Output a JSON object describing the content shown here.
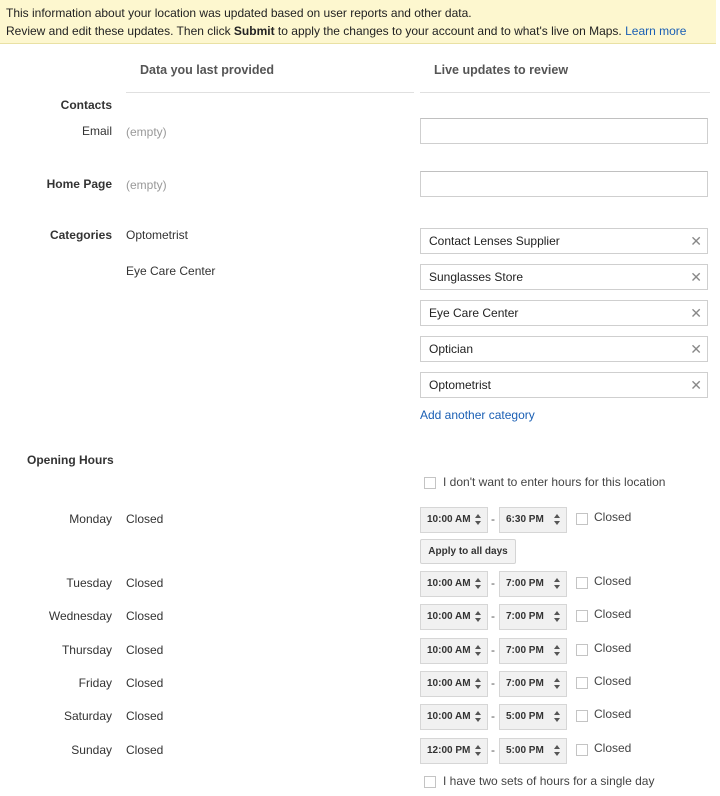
{
  "banner": {
    "line1": "This information about your location was updated based on user reports and other data.",
    "line2_a": "Review and edit these updates. Then click ",
    "line2_bold": "Submit",
    "line2_b": " to apply the changes to your account and to what's live on Maps. ",
    "learn_more": "Learn more"
  },
  "columns": {
    "left": "Data you last provided",
    "right": "Live updates to review"
  },
  "contacts": {
    "section_label": "Contacts",
    "email_label": "Email",
    "email_old": "(empty)",
    "email_new": ""
  },
  "homepage": {
    "label": "Home Page",
    "old": "(empty)",
    "new": ""
  },
  "categories": {
    "label": "Categories",
    "old": [
      "Optometrist",
      "Eye Care Center"
    ],
    "new": [
      "Contact Lenses Supplier",
      "Sunglasses Store",
      "Eye Care Center",
      "Optician",
      "Optometrist"
    ],
    "remove_glyph": "✕",
    "add_link": "Add another category"
  },
  "hours": {
    "label": "Opening Hours",
    "no_hours_label": "I don't want to enter hours for this location",
    "apply_all": "Apply to all days",
    "closed_label": "Closed",
    "dash": "-",
    "two_sets_label": "I have two sets of hours for a single day",
    "days": [
      {
        "day": "Monday",
        "old": "Closed",
        "open": "10:00 AM",
        "close": "6:30 PM"
      },
      {
        "day": "Tuesday",
        "old": "Closed",
        "open": "10:00 AM",
        "close": "7:00 PM"
      },
      {
        "day": "Wednesday",
        "old": "Closed",
        "open": "10:00 AM",
        "close": "7:00 PM"
      },
      {
        "day": "Thursday",
        "old": "Closed",
        "open": "10:00 AM",
        "close": "7:00 PM"
      },
      {
        "day": "Friday",
        "old": "Closed",
        "open": "10:00 AM",
        "close": "7:00 PM"
      },
      {
        "day": "Saturday",
        "old": "Closed",
        "open": "10:00 AM",
        "close": "5:00 PM"
      },
      {
        "day": "Sunday",
        "old": "Closed",
        "open": "12:00 PM",
        "close": "5:00 PM"
      }
    ]
  }
}
